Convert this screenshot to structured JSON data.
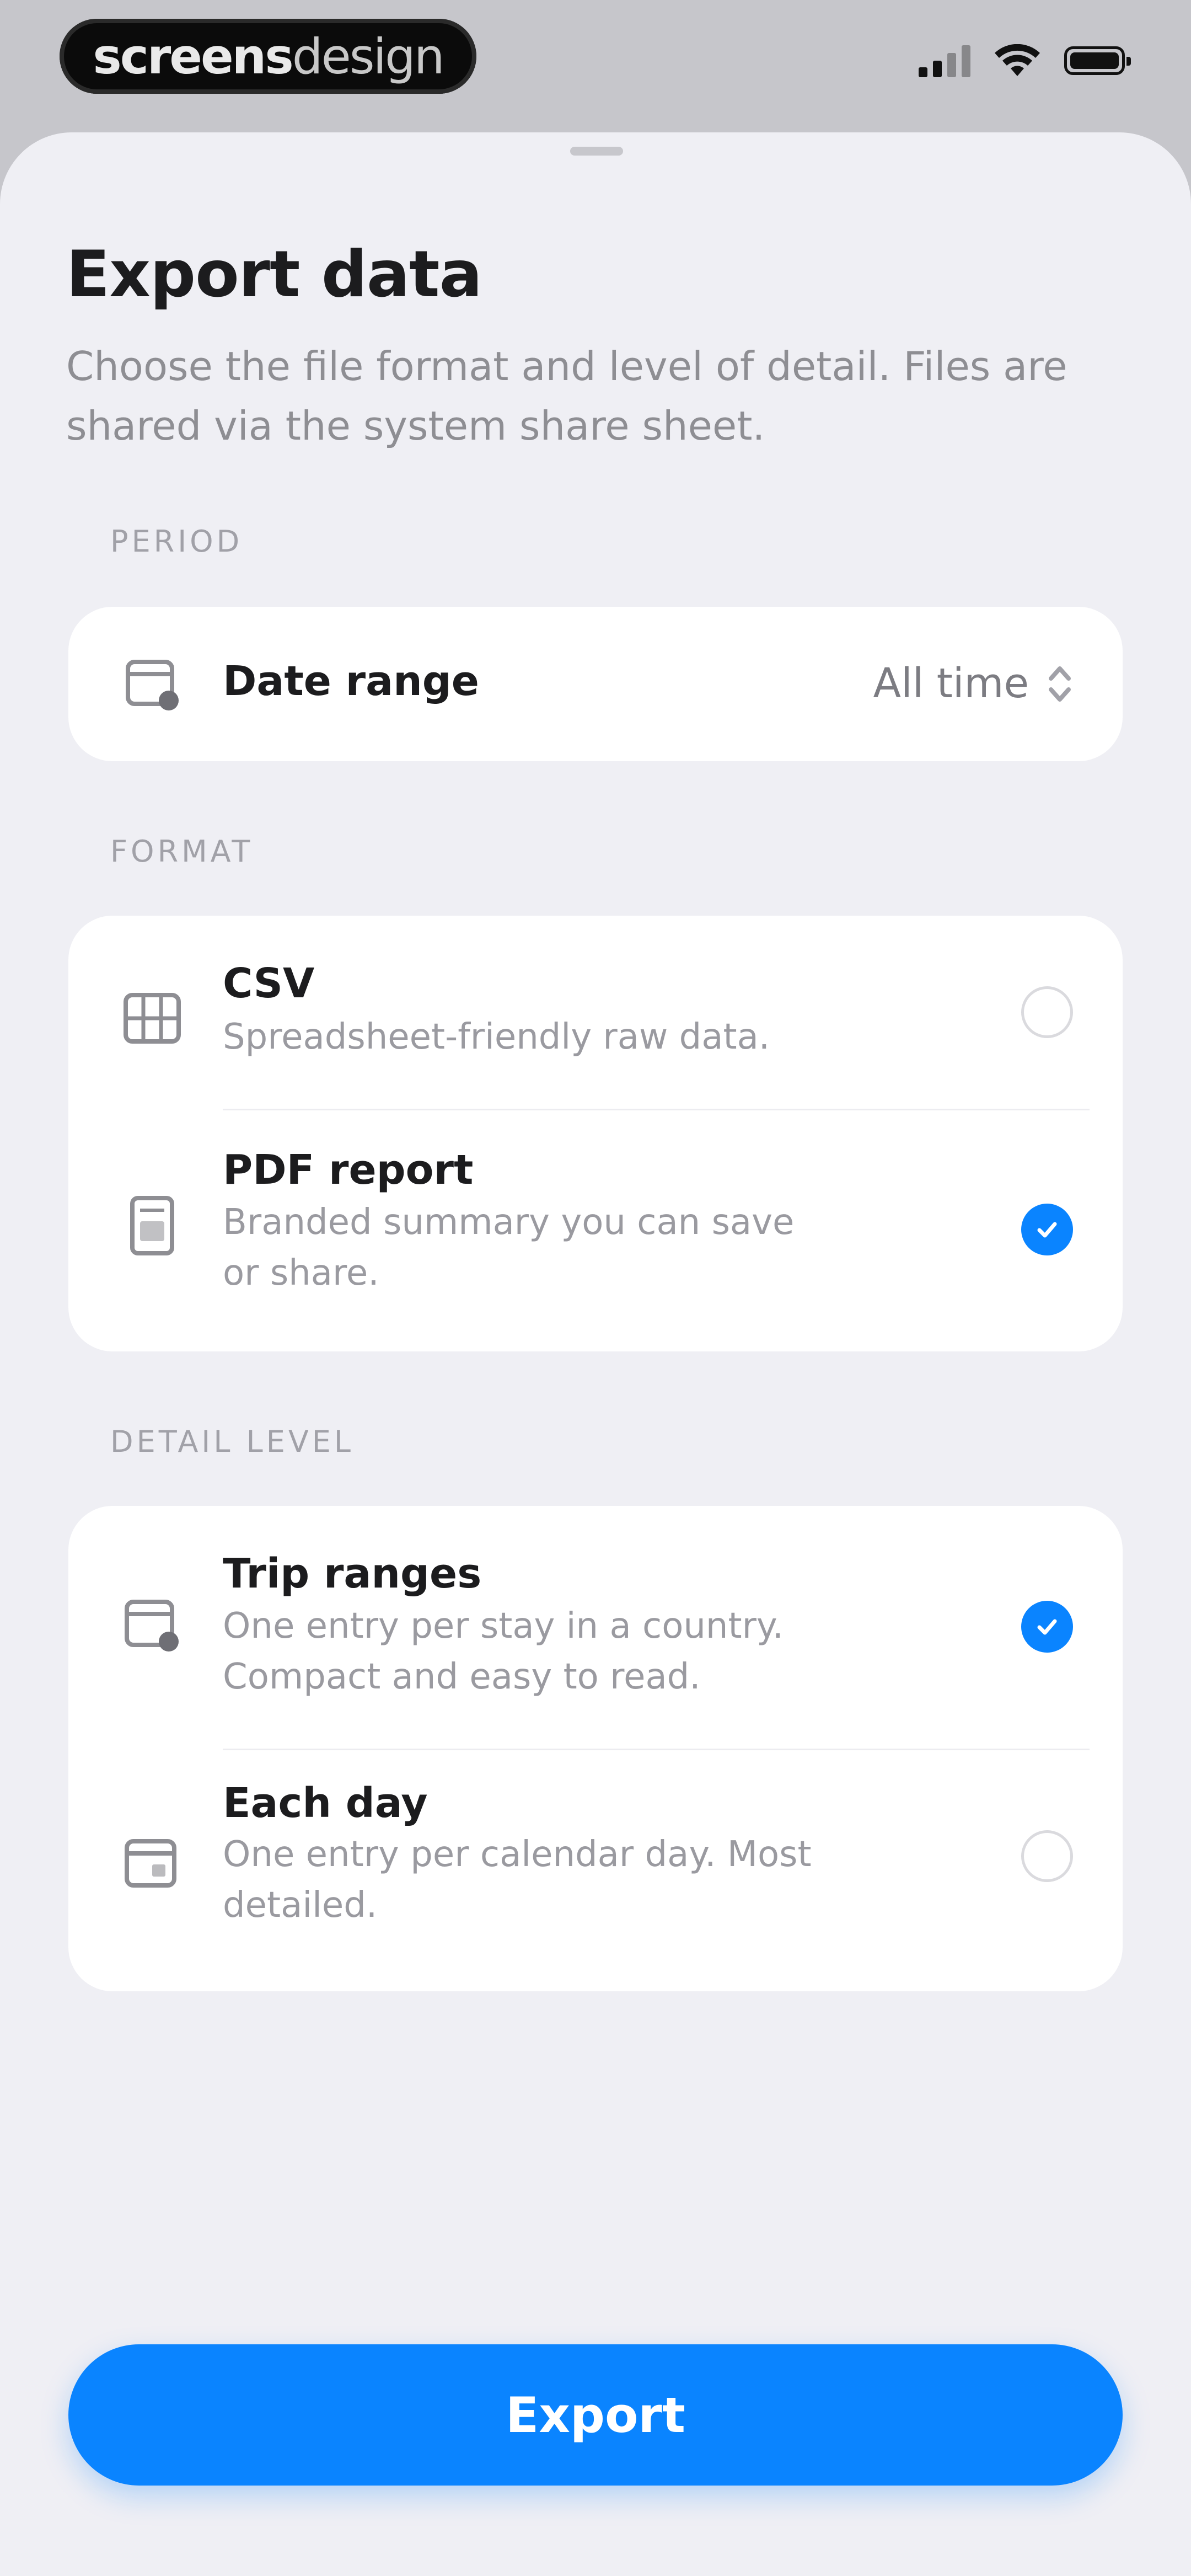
{
  "status_bar": {
    "brand_bold": "screens",
    "brand_light": "design"
  },
  "sheet": {
    "title": "Export data",
    "subtitle": "Choose the file format and level of detail. Files are shared via the system share sheet."
  },
  "period": {
    "label": "PERIOD",
    "date_range_label": "Date range",
    "date_range_value": "All time",
    "icon": "calendar-icon"
  },
  "format": {
    "label": "FORMAT",
    "options": [
      {
        "title": "CSV",
        "subtitle": "Spreadsheet-friendly raw data.",
        "selected": false,
        "icon": "table-icon"
      },
      {
        "title": "PDF report",
        "subtitle": "Branded summary you can save or share.",
        "selected": true,
        "icon": "document-icon"
      }
    ]
  },
  "detail": {
    "label": "DETAIL LEVEL",
    "options": [
      {
        "title": "Trip ranges",
        "subtitle": "One entry per stay in a country. Compact and easy to read.",
        "selected": true,
        "icon": "calendar-clock-icon"
      },
      {
        "title": "Each day",
        "subtitle": "One entry per calendar day. Most detailed.",
        "selected": false,
        "icon": "calendar-icon"
      }
    ]
  },
  "actions": {
    "export_label": "Export"
  },
  "colors": {
    "accent": "#0a84ff",
    "sheet_bg": "#efeff4",
    "card_bg": "#ffffff"
  }
}
